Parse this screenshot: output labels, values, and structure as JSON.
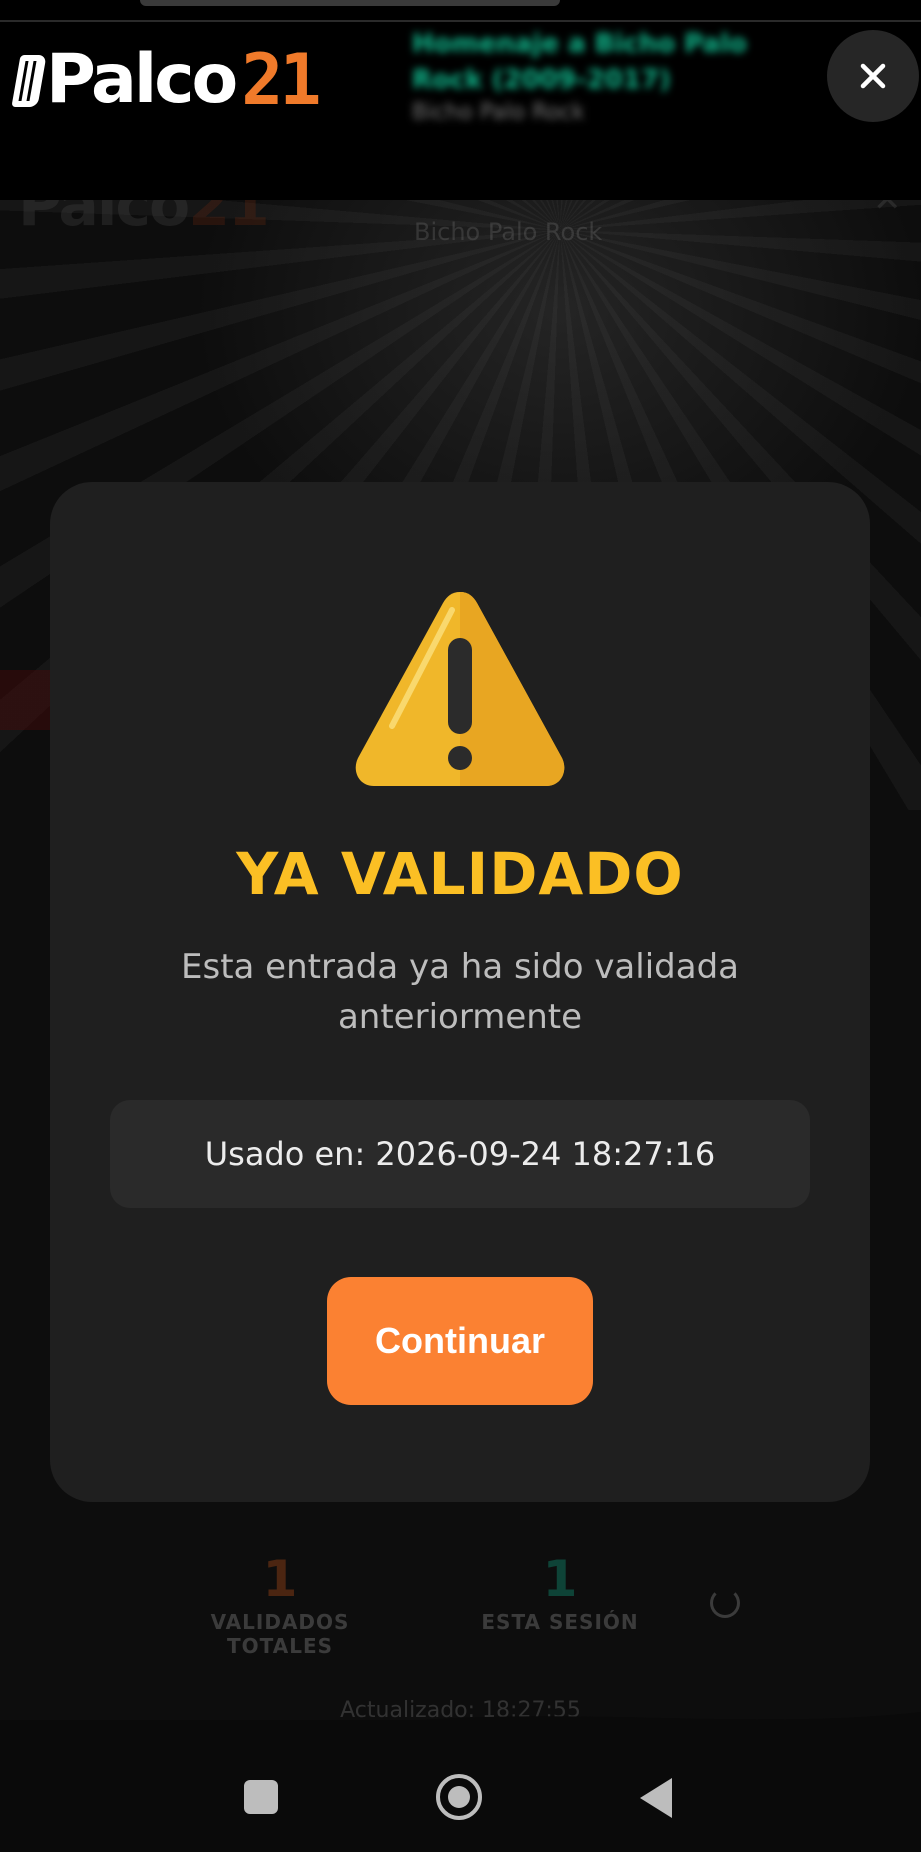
{
  "header": {
    "logo_text": "Palco",
    "logo_number": "21",
    "blurred_event_title": "Homenaje a Bicho Palo Rock (2009-2017)",
    "blurred_event_subtitle": "Bicho Palo Rock",
    "close_icon": "close-icon"
  },
  "background": {
    "event_subtitle": "Bicho Palo Rock",
    "stats": [
      {
        "value": "1",
        "label": "VALIDADOS TOTALES"
      },
      {
        "value": "1",
        "label": "ESTA SESIÓN"
      }
    ],
    "updated_text": "Actualizado: 18:27:55"
  },
  "modal": {
    "icon": "warning-icon",
    "title": "YA VALIDADO",
    "message": "Esta entrada ya ha sido validada anteriormente",
    "used_at": "Usado en: 2026-09-24 18:27:16",
    "continue_label": "Continuar"
  },
  "nav": {
    "recents_icon": "recents-icon",
    "home_icon": "home-icon",
    "back_icon": "back-icon"
  },
  "colors": {
    "accent": "#fb8132",
    "warning": "#fbbf24",
    "modal_bg": "#1f1f1f"
  }
}
